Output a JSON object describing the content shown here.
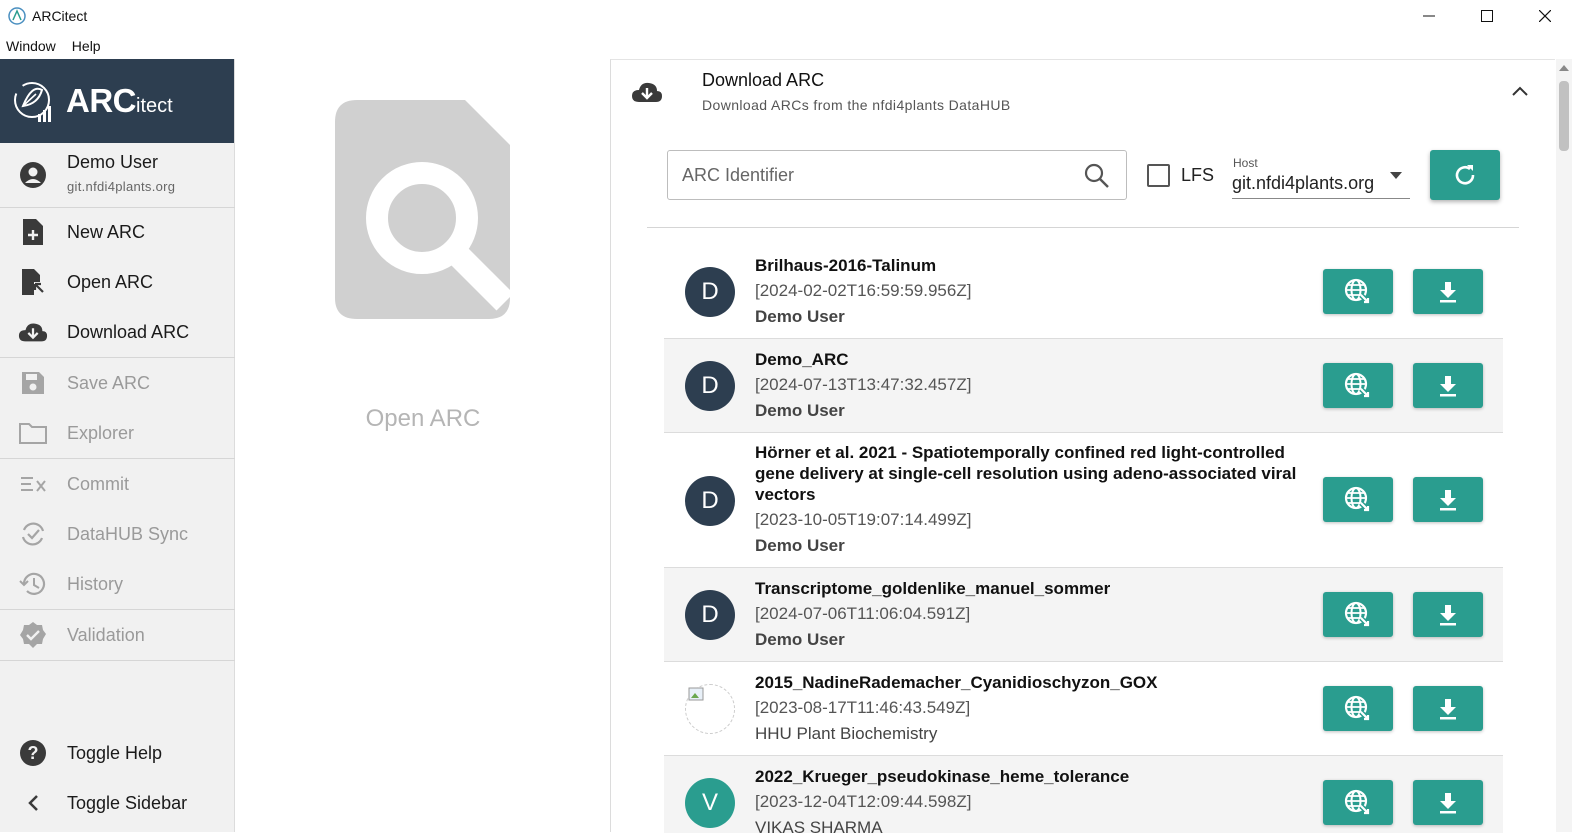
{
  "window": {
    "title": "ARCitect",
    "menu": [
      "Window",
      "Help"
    ]
  },
  "sidebar": {
    "logo_main": "ARC",
    "logo_suffix": "itect",
    "user": {
      "name": "Demo User",
      "host": "git.nfdi4plants.org"
    },
    "items": [
      {
        "label": "New ARC",
        "icon": "new-file-icon",
        "enabled": true
      },
      {
        "label": "Open ARC",
        "icon": "open-file-icon",
        "enabled": true
      },
      {
        "label": "Download ARC",
        "icon": "cloud-download-icon",
        "enabled": true
      },
      {
        "label": "Save ARC",
        "icon": "save-icon",
        "enabled": false
      },
      {
        "label": "Explorer",
        "icon": "folder-icon",
        "enabled": false
      },
      {
        "label": "Commit",
        "icon": "commit-icon",
        "enabled": false
      },
      {
        "label": "DataHUB Sync",
        "icon": "sync-icon",
        "enabled": false
      },
      {
        "label": "History",
        "icon": "history-icon",
        "enabled": false
      },
      {
        "label": "Validation",
        "icon": "verified-icon",
        "enabled": false
      },
      {
        "label": "Toggle Help",
        "icon": "help-icon",
        "enabled": true
      },
      {
        "label": "Toggle Sidebar",
        "icon": "chevron-left-icon",
        "enabled": true
      }
    ]
  },
  "open_area": {
    "label": "Open ARC"
  },
  "download_panel": {
    "title": "Download ARC",
    "subtitle": "Download ARCs from the nfdi4plants DataHUB",
    "search_placeholder": "ARC Identifier",
    "lfs_label": "LFS",
    "lfs_checked": false,
    "host_label": "Host",
    "host_value": "git.nfdi4plants.org",
    "accent_color": "#2a9d8f",
    "results": [
      {
        "avatar": "D",
        "title": "Brilhaus-2016-Talinum",
        "date": "[2024-02-02T16:59:59.956Z]",
        "owner": "Demo User"
      },
      {
        "avatar": "D",
        "title": "Demo_ARC",
        "date": "[2024-07-13T13:47:32.457Z]",
        "owner": "Demo User"
      },
      {
        "avatar": "D",
        "title": "Hörner et al. 2021 - Spatiotemporally confined red light-controlled gene delivery at single-cell resolution using adeno-associated viral vectors",
        "date": "[2023-10-05T19:07:14.499Z]",
        "owner": "Demo User"
      },
      {
        "avatar": "D",
        "title": "Transcriptome_goldenlike_manuel_sommer",
        "date": "[2024-07-06T11:06:04.591Z]",
        "owner": "Demo User"
      },
      {
        "avatar": "",
        "title": "2015_NadineRademacher_Cyanidioschyzon_GOX",
        "date": "[2023-08-17T11:46:43.549Z]",
        "owner": "HHU Plant Biochemistry"
      },
      {
        "avatar": "V",
        "title": "2022_Krueger_pseudokinase_heme_tolerance",
        "date": "[2023-12-04T12:09:44.598Z]",
        "owner": "VIKAS SHARMA"
      }
    ]
  }
}
